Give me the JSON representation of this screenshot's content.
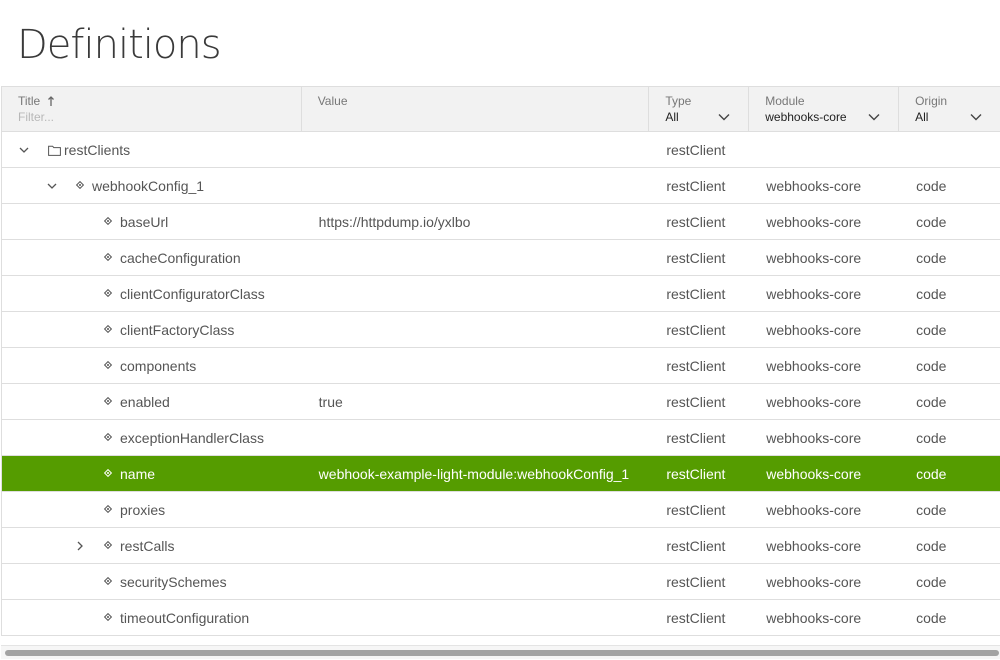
{
  "page": {
    "title": "Definitions"
  },
  "columns": {
    "title": {
      "label": "Title",
      "filter_placeholder": "Filter..."
    },
    "value": {
      "label": "Value"
    },
    "type": {
      "label": "Type",
      "selected": "All"
    },
    "module": {
      "label": "Module",
      "selected": "webhooks-core"
    },
    "origin": {
      "label": "Origin",
      "selected": "All"
    }
  },
  "colors": {
    "selected_row": "#559c00",
    "text": "#555555",
    "border": "#dedede"
  },
  "rows": [
    {
      "title": "restClients",
      "value": "",
      "type": "restClient",
      "module": "",
      "origin": "",
      "level": 0,
      "node": "folder",
      "expander": "expanded"
    },
    {
      "title": "webhookConfig_1",
      "value": "",
      "type": "restClient",
      "module": "webhooks-core",
      "origin": "code",
      "level": 1,
      "node": "item",
      "expander": "expanded"
    },
    {
      "title": "baseUrl",
      "value": "https://httpdump.io/yxlbo",
      "type": "restClient",
      "module": "webhooks-core",
      "origin": "code",
      "level": 2,
      "node": "item",
      "expander": "none"
    },
    {
      "title": "cacheConfiguration",
      "value": "",
      "type": "restClient",
      "module": "webhooks-core",
      "origin": "code",
      "level": 2,
      "node": "item",
      "expander": "none"
    },
    {
      "title": "clientConfiguratorClass",
      "value": "",
      "type": "restClient",
      "module": "webhooks-core",
      "origin": "code",
      "level": 2,
      "node": "item",
      "expander": "none"
    },
    {
      "title": "clientFactoryClass",
      "value": "",
      "type": "restClient",
      "module": "webhooks-core",
      "origin": "code",
      "level": 2,
      "node": "item",
      "expander": "none"
    },
    {
      "title": "components",
      "value": "",
      "type": "restClient",
      "module": "webhooks-core",
      "origin": "code",
      "level": 2,
      "node": "item",
      "expander": "none"
    },
    {
      "title": "enabled",
      "value": "true",
      "type": "restClient",
      "module": "webhooks-core",
      "origin": "code",
      "level": 2,
      "node": "item",
      "expander": "none"
    },
    {
      "title": "exceptionHandlerClass",
      "value": "",
      "type": "restClient",
      "module": "webhooks-core",
      "origin": "code",
      "level": 2,
      "node": "item",
      "expander": "none"
    },
    {
      "title": "name",
      "value": "webhook-example-light-module:webhookConfig_1",
      "type": "restClient",
      "module": "webhooks-core",
      "origin": "code",
      "level": 2,
      "node": "item",
      "expander": "none",
      "selected": true
    },
    {
      "title": "proxies",
      "value": "",
      "type": "restClient",
      "module": "webhooks-core",
      "origin": "code",
      "level": 2,
      "node": "item",
      "expander": "none"
    },
    {
      "title": "restCalls",
      "value": "",
      "type": "restClient",
      "module": "webhooks-core",
      "origin": "code",
      "level": 2,
      "node": "item",
      "expander": "collapsed"
    },
    {
      "title": "securitySchemes",
      "value": "",
      "type": "restClient",
      "module": "webhooks-core",
      "origin": "code",
      "level": 2,
      "node": "item",
      "expander": "none"
    },
    {
      "title": "timeoutConfiguration",
      "value": "",
      "type": "restClient",
      "module": "webhooks-core",
      "origin": "code",
      "level": 2,
      "node": "item",
      "expander": "none"
    }
  ]
}
